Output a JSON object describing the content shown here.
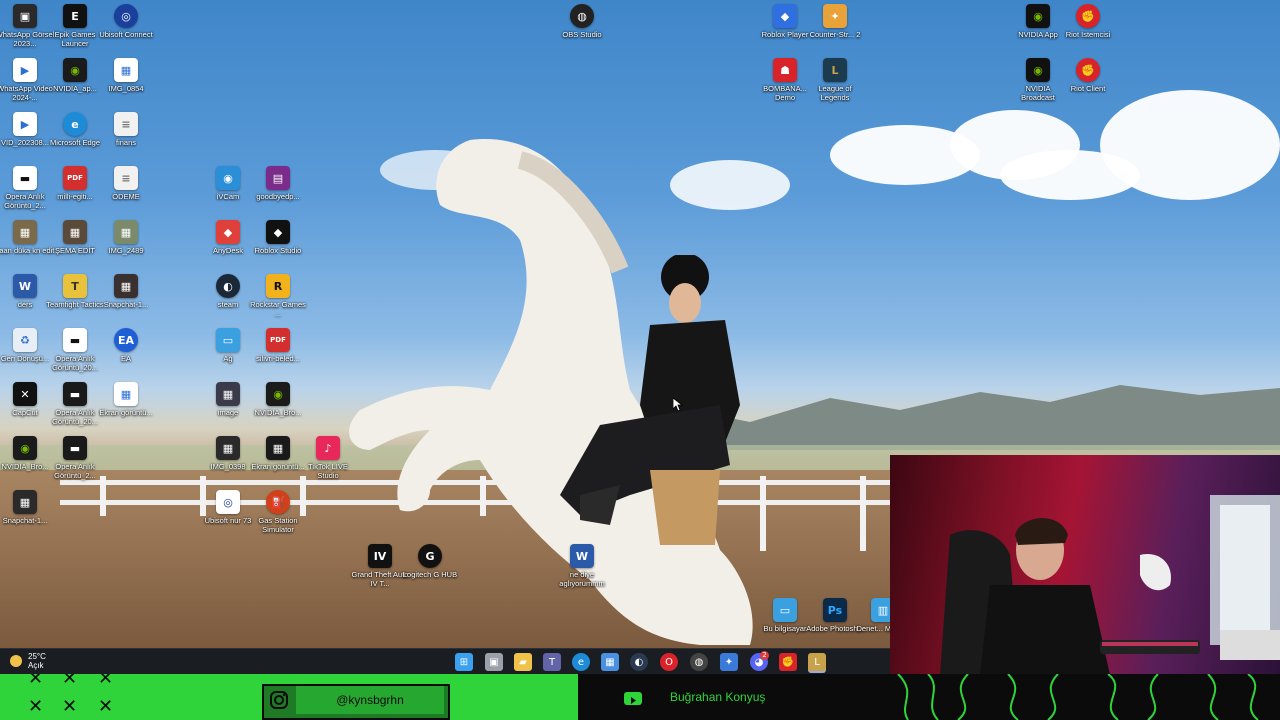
{
  "desktop_icons": [
    {
      "label": "WhatsApp Görsel 2023...",
      "icon": "whatsapp-image-icon",
      "color": "#2a2a2a"
    },
    {
      "label": "Epik Games Launcer",
      "icon": "epic-games-icon",
      "color": "#111111"
    },
    {
      "label": "Ubisoft Connect",
      "icon": "ubisoft-icon",
      "color": "#1b3f9c"
    },
    {
      "label": "OBS Studio",
      "icon": "obs-icon",
      "color": "#222222"
    },
    {
      "label": "Roblox Player",
      "icon": "roblox-player-icon",
      "color": "#2f6fe0"
    },
    {
      "label": "Counter-Str... 2",
      "icon": "counter-strike-icon",
      "color": "#e8a23a"
    },
    {
      "label": "NVIDIA App",
      "icon": "nvidia-app-icon",
      "color": "#111111"
    },
    {
      "label": "Riot İstemcisi",
      "icon": "riot-client-icon",
      "color": "#d8232a"
    },
    {
      "label": "WhatsApp Video 2024-...",
      "icon": "whatsapp-video-icon",
      "color": "#ffffff"
    },
    {
      "label": "NVIDIA_ap...",
      "icon": "nvidia-shortcut-icon",
      "color": "#1b1b1b"
    },
    {
      "label": "IMG_0854",
      "icon": "image-file-icon",
      "color": "#ffffff"
    },
    {
      "label": "BOMBANA... Demo",
      "icon": "bombana-demo-icon",
      "color": "#d8232a"
    },
    {
      "label": "League of Legends",
      "icon": "league-of-legends-icon",
      "color": "#1d3b4f"
    },
    {
      "label": "NVIDIA Broadcast",
      "icon": "nvidia-broadcast-icon",
      "color": "#111111"
    },
    {
      "label": "Riot Client",
      "icon": "riot-client-icon",
      "color": "#d8232a"
    },
    {
      "label": "VID_202308...",
      "icon": "video-file-icon",
      "color": "#ffffff"
    },
    {
      "label": "Microsoft Edge",
      "icon": "edge-icon",
      "color": "#1e8bd6"
    },
    {
      "label": "finans",
      "icon": "text-file-icon",
      "color": "#f1f1f1"
    },
    {
      "label": "Opera Anlık Görüntü_2...",
      "icon": "opera-snapshot-icon",
      "color": "#ffffff"
    },
    {
      "label": "milli-egiti...",
      "icon": "pdf-file-icon",
      "color": "#d32f2f"
    },
    {
      "label": "ÖDEME",
      "icon": "text-file-icon",
      "color": "#f1f1f1"
    },
    {
      "label": "iVCam",
      "icon": "ivcam-icon",
      "color": "#2b8fd8"
    },
    {
      "label": "goodbyedp...",
      "icon": "winrar-archive-icon",
      "color": "#7b2b8a"
    },
    {
      "label": "kaan düka kn edit",
      "icon": "photo-thumbnail-icon",
      "color": "#7a6a4a"
    },
    {
      "label": "ŞEMA EDİT",
      "icon": "photo-thumbnail-icon",
      "color": "#5a4a3a"
    },
    {
      "label": "IMG_2489",
      "icon": "image-file-icon",
      "color": "#7a8a6a"
    },
    {
      "label": "AnyDesk",
      "icon": "anydesk-icon",
      "color": "#e0403a"
    },
    {
      "label": "Roblox Studio",
      "icon": "roblox-studio-icon",
      "color": "#111111"
    },
    {
      "label": "ders",
      "icon": "word-document-icon",
      "color": "#2b5aa8"
    },
    {
      "label": "Teamfight Tactics",
      "icon": "teamfight-tactics-icon",
      "color": "#e8c23a"
    },
    {
      "label": "Snapchat-1...",
      "icon": "photo-thumbnail-icon",
      "color": "#3a3030"
    },
    {
      "label": "steam",
      "icon": "steam-icon",
      "color": "#1b2838"
    },
    {
      "label": "Rockstar Games ...",
      "icon": "rockstar-icon",
      "color": "#f1b21b"
    },
    {
      "label": "Geri Dönüşü...",
      "icon": "recycle-bin-icon",
      "color": "#e8eef5"
    },
    {
      "label": "Opera Anlık Görüntü_20...",
      "icon": "opera-snapshot-icon",
      "color": "#ffffff"
    },
    {
      "label": "EA",
      "icon": "ea-icon",
      "color": "#1f5fd6"
    },
    {
      "label": "Ağ",
      "icon": "network-icon",
      "color": "#3aa0e0"
    },
    {
      "label": "silivri-beled...",
      "icon": "pdf-file-icon",
      "color": "#d32f2f"
    },
    {
      "label": "CapCut",
      "icon": "capcut-icon",
      "color": "#111111"
    },
    {
      "label": "Opera Anlık Görüntü_20...",
      "icon": "opera-snapshot-icon",
      "color": "#1a1a1a"
    },
    {
      "label": "Ekran görüntü...",
      "icon": "image-file-icon",
      "color": "#ffffff"
    },
    {
      "label": "image",
      "icon": "photo-thumbnail-icon",
      "color": "#3a3a4a"
    },
    {
      "label": "NVIDIA_Bro...",
      "icon": "nvidia-shortcut-icon",
      "color": "#1b1b1b"
    },
    {
      "label": "NVIDIA_Bro...",
      "icon": "nvidia-shortcut-icon",
      "color": "#1b1b1b"
    },
    {
      "label": "Opera Anlık Görüntü_2...",
      "icon": "opera-snapshot-icon",
      "color": "#1a1a1a"
    },
    {
      "label": "IMG_0398",
      "icon": "photo-thumbnail-icon",
      "color": "#2a2a2a"
    },
    {
      "label": "Ekran görüntü...",
      "icon": "image-file-icon",
      "color": "#1a1a1a"
    },
    {
      "label": "TikTok LIVE Studio",
      "icon": "tiktok-live-studio-icon",
      "color": "#e8285a"
    },
    {
      "label": "Snapchat-1...",
      "icon": "photo-thumbnail-icon",
      "color": "#2a2a2a"
    },
    {
      "label": "Ubisoft nur 73",
      "icon": "ubisoft-file-icon",
      "color": "#ffffff"
    },
    {
      "label": "Gas Station Simulator",
      "icon": "gas-station-simulator-icon",
      "color": "#d0401a"
    },
    {
      "label": "Grand Theft Auto IV T...",
      "icon": "gta-iv-icon",
      "color": "#111111"
    },
    {
      "label": "Logitech G HUB",
      "icon": "logitech-ghub-icon",
      "color": "#111111"
    },
    {
      "label": "ne diye aglıyorummm",
      "icon": "word-document-icon",
      "color": "#2b5aa8"
    },
    {
      "label": "Bu bilgisayar",
      "icon": "this-pc-icon",
      "color": "#3aa0e0"
    },
    {
      "label": "Adobe Photosh...",
      "icon": "photoshop-icon",
      "color": "#0b2a4a"
    },
    {
      "label": "Denet... Masa...",
      "icon": "control-panel-icon",
      "color": "#3aa0e0"
    }
  ],
  "weather": {
    "temp": "25°C",
    "condition": "Açık"
  },
  "taskbar": {
    "apps": [
      {
        "name": "windows-start-icon",
        "color": "#3aa0f0"
      },
      {
        "name": "task-view-icon",
        "color": "#9aa0a8"
      },
      {
        "name": "file-explorer-icon",
        "color": "#f1c24a"
      },
      {
        "name": "teams-icon",
        "color": "#6264a7"
      },
      {
        "name": "edge-icon",
        "color": "#1e8bd6"
      },
      {
        "name": "microsoft-store-icon",
        "color": "#4a90e2"
      },
      {
        "name": "steam-icon",
        "color": "#2a3a50"
      },
      {
        "name": "opera-gx-icon",
        "color": "#d8232a"
      },
      {
        "name": "obs-icon",
        "color": "#444444"
      },
      {
        "name": "unknown-app-icon",
        "color": "#3a7ad8"
      },
      {
        "name": "discord-icon",
        "color": "#5865f2"
      },
      {
        "name": "riot-client-icon",
        "color": "#d8232a"
      },
      {
        "name": "league-of-legends-icon",
        "color": "#c8a24a"
      }
    ],
    "discord_badge": "2"
  },
  "stream_banner": {
    "instagram_handle": "@kynsbgrhn",
    "youtube_channel": "Buğrahan Konyuş",
    "accent_color": "#2fd43a"
  }
}
